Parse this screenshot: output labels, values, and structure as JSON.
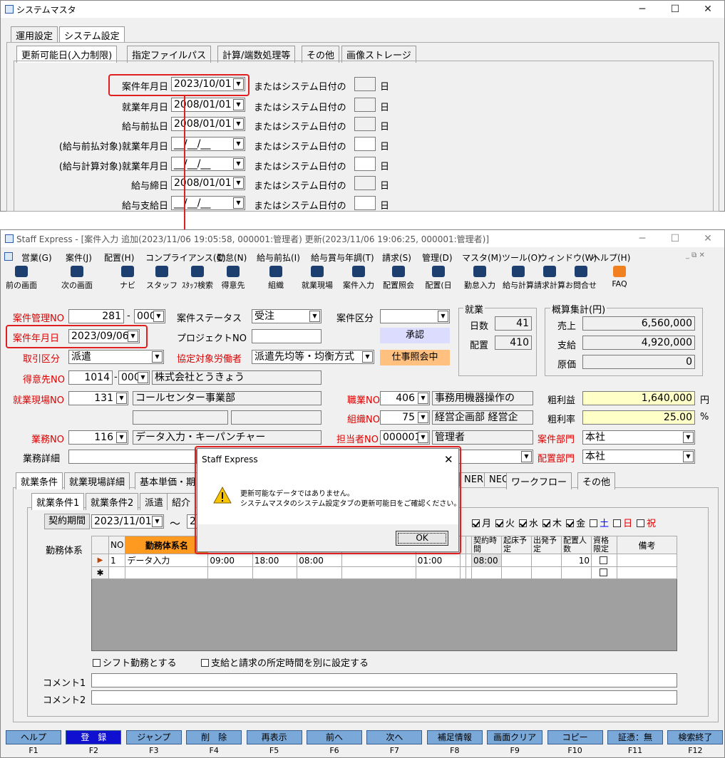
{
  "top_window": {
    "title": "システムマスタ",
    "tabs": [
      "運用設定",
      "システム設定"
    ],
    "subtabs": [
      "更新可能日(入力制限)",
      "指定ファイルパス",
      "計算/端数処理等",
      "その他",
      "画像ストレージ"
    ],
    "rows": [
      {
        "label": "案件年月日",
        "date": "2023/10/01",
        "or": "またはシステム日付の",
        "day": "日"
      },
      {
        "label": "就業年月日",
        "date": "2008/01/01",
        "or": "またはシステム日付の",
        "day": "日"
      },
      {
        "label": "給与前払日",
        "date": "2008/01/01",
        "or": "またはシステム日付の",
        "day": "日"
      },
      {
        "label": "(給与前払対象)就業年月日",
        "date": "__/__/__",
        "or": "またはシステム日付の",
        "day": "日"
      },
      {
        "label": "(給与計算対象)就業年月日",
        "date": "__/__/__",
        "or": "またはシステム日付の",
        "day": "日"
      },
      {
        "label": "給与締日",
        "date": "2008/01/01",
        "or": "またはシステム日付の",
        "day": "日"
      },
      {
        "label": "給与支給日",
        "date": "__/__/__",
        "or": "またはシステム日付の",
        "day": "日"
      }
    ]
  },
  "main_window": {
    "title": "Staff Express - [案件入力 追加(2023/11/06 19:05:58, 000001:管理者) 更新(2023/11/06 19:06:25, 000001:管理者)]",
    "menu": [
      "営業(G)",
      "案件(J)",
      "配置(H)",
      "コンプライアンス(C)",
      "勤怠(N)",
      "給与前払(I)",
      "給与賞与年調(T)",
      "請求(S)",
      "管理(D)",
      "マスタ(M)",
      "ツール(O)",
      "ウィンドウ(W)",
      "ヘルプ(H)"
    ],
    "toolbar": [
      "前の画面",
      "次の画面",
      "ナビ",
      "スタッフ",
      "ｽﾀｯﾌ検索",
      "得意先",
      "組織",
      "就業現場",
      "案件入力",
      "配置照会",
      "配置(日",
      "勤怠入力",
      "給与計算",
      "請求計算",
      "お問合せ",
      "FAQ"
    ],
    "form": {
      "kanri_no_label": "案件管理NO",
      "kanri_no": "281",
      "kanri_sub": "000",
      "status_label": "案件ステータス",
      "status": "受注",
      "kubun_label": "案件区分",
      "date_label": "案件年月日",
      "date": "2023/09/06",
      "project_label": "プロジェクトNO",
      "torihiki_label": "取引区分",
      "torihiki": "派遣",
      "kyotei_label": "協定対象労働者",
      "kyotei": "派遣先均等・均衡方式",
      "tokui_label": "得意先NO",
      "tokui_no": "1014",
      "tokui_sub": "000",
      "tokui_name": "株式会社とうきょう",
      "genba_label": "就業現場NO",
      "genba_no": "131",
      "genba_name": "コールセンター事業部",
      "gyomu_label": "業務NO",
      "gyomu_no": "116",
      "gyomu_name": "データ入力・キーパンチャー",
      "gyomu_detail_label": "業務詳細",
      "shokugyo_label": "職業NO",
      "shokugyo_no": "406",
      "shokugyo_name": "事務用機器操作の",
      "soshiki_label": "組織NO",
      "soshiki_no": "75",
      "soshiki_name": "経営企画部 経営企",
      "tanto_label": "担当者NO",
      "tanto_no": "000001",
      "tanto_name": "管理者",
      "anken_bumon_label": "案件部門",
      "anken_bumon": "本社",
      "haichi_bumon_label": "配置部門",
      "haichi_bumon": "本社",
      "approve": "承認",
      "shoukai": "仕事照会中"
    },
    "shugyo": {
      "title": "就業",
      "nissu_label": "日数",
      "nissu": "41",
      "haichi_label": "配置",
      "haichi": "410"
    },
    "gaisan": {
      "title": "概算集計(円)",
      "uriage_label": "売上",
      "uriage": "6,560,000",
      "shikyu_label": "支給",
      "shikyu": "4,920,000",
      "genka_label": "原価",
      "genka": "0"
    },
    "arari_label": "粗利益",
    "arari": "1,640,000",
    "arari_unit": "円",
    "ararisitu_label": "粗利率",
    "ararisitu": "25.00",
    "ararisitu_unit": "%",
    "tabs": [
      "就業条件",
      "就業現場詳細",
      "基本単価・期",
      "NER",
      "NEO",
      "ワークフロー",
      "その他"
    ],
    "subtabs": [
      "就業条件1",
      "就業条件2",
      "派遣",
      "紹介"
    ],
    "keiyaku_label": "契約期間",
    "keiyaku_from": "2023/11/01",
    "tilde": "～",
    "keiyaku_to": "2",
    "weekdays": [
      "月",
      "火",
      "水",
      "木",
      "金",
      "土",
      "日",
      "祝"
    ],
    "kinmu_label": "勤務体系",
    "grid_headers": [
      "NO",
      "勤務体系名",
      "契約時間",
      "起床予定",
      "出発予定",
      "配置人数",
      "資格限定",
      "備考"
    ],
    "grid_row": {
      "no": "1",
      "name": "データ入力",
      "start": "09:00",
      "end": "18:00",
      "t": "08:00",
      "rest": "01:00",
      "keiyaku": "08:00",
      "ninzu": "10"
    },
    "shift_label": "シフト勤務とする",
    "separate_label": "支給と請求の所定時間を別に設定する",
    "comment1": "コメント1",
    "comment2": "コメント2"
  },
  "dialog": {
    "title": "Staff Express",
    "line1": "更新可能なデータではありません。",
    "line2": "システムマスタのシステム設定タブの更新可能日をご確認ください。",
    "ok": "OK"
  },
  "fkeys": [
    {
      "label": "ヘルプ",
      "key": "F1"
    },
    {
      "label": "登　録",
      "key": "F2"
    },
    {
      "label": "ジャンプ",
      "key": "F3"
    },
    {
      "label": "削　除",
      "key": "F4"
    },
    {
      "label": "再表示",
      "key": "F5"
    },
    {
      "label": "前へ",
      "key": "F6"
    },
    {
      "label": "次へ",
      "key": "F7"
    },
    {
      "label": "補足情報",
      "key": "F8"
    },
    {
      "label": "画面クリア",
      "key": "F9"
    },
    {
      "label": "コピー",
      "key": "F10"
    },
    {
      "label": "証憑：無",
      "key": "F11"
    },
    {
      "label": "検索終了",
      "key": "F12"
    }
  ],
  "colors": {
    "highlight": "#e02020",
    "fkey_bg": "#7aa8d8",
    "fkey_active": "#1010d0",
    "approve_bg": "#dcdcff",
    "shoukai_bg": "#ffc080",
    "yellow": "#ffffc8"
  }
}
